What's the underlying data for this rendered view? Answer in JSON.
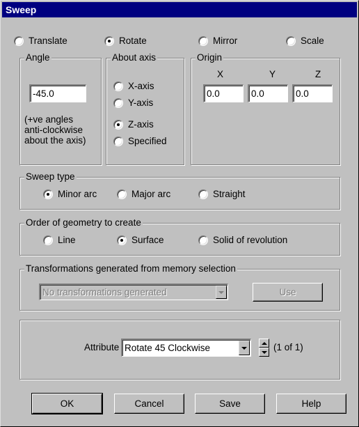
{
  "window": {
    "title": "Sweep"
  },
  "transform_mode": {
    "options": [
      {
        "label": "Translate",
        "selected": false
      },
      {
        "label": "Rotate",
        "selected": true
      },
      {
        "label": "Mirror",
        "selected": false
      },
      {
        "label": "Scale",
        "selected": false
      }
    ]
  },
  "angle": {
    "label": "Angle",
    "value": "-45.0",
    "note_lines": [
      "(+ve angles",
      "anti-clockwise",
      "about the axis)"
    ]
  },
  "about_axis": {
    "label": "About axis",
    "options": [
      {
        "label": "X-axis",
        "selected": false
      },
      {
        "label": "Y-axis",
        "selected": false
      },
      {
        "label": "Z-axis",
        "selected": true
      },
      {
        "label": "Specified",
        "selected": false
      }
    ]
  },
  "origin": {
    "label": "Origin",
    "x_label": "X",
    "y_label": "Y",
    "z_label": "Z",
    "x_value": "0.0",
    "y_value": "0.0",
    "z_value": "0.0"
  },
  "sweep_type": {
    "label": "Sweep type",
    "options": [
      {
        "label": "Minor arc",
        "selected": true
      },
      {
        "label": "Major arc",
        "selected": false
      },
      {
        "label": "Straight",
        "selected": false
      }
    ]
  },
  "order": {
    "label": "Order of geometry to create",
    "options": [
      {
        "label": "Line",
        "selected": false
      },
      {
        "label": "Surface",
        "selected": true
      },
      {
        "label": "Solid of revolution",
        "selected": false
      }
    ]
  },
  "transformations": {
    "label": "Transformations generated from memory selection",
    "combo_value": "No transformations generated",
    "use_label": "Use"
  },
  "attribute": {
    "label": "Attribute",
    "value": "Rotate 45 Clockwise",
    "count": "(1 of 1)"
  },
  "buttons": {
    "ok": "OK",
    "cancel": "Cancel",
    "save": "Save",
    "help": "Help"
  }
}
